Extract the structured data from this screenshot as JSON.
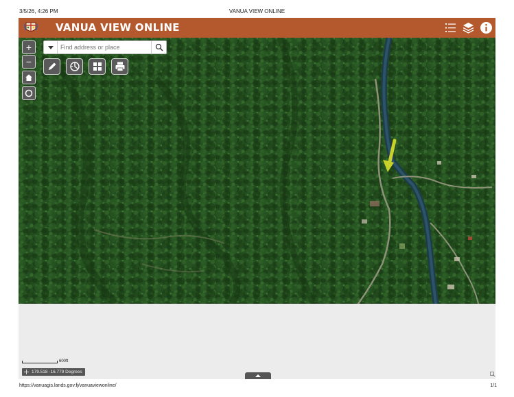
{
  "print": {
    "date": "3/5/26, 4:26 PM",
    "doc_title": "VANUA VIEW ONLINE",
    "url": "https://vanuagis.lands.gov.fj/vanuaviewonline/",
    "page_number": "1/1"
  },
  "app": {
    "title": "VANUA VIEW ONLINE",
    "header_color": "#b4582e"
  },
  "header_icons": [
    "list-icon",
    "layers-icon",
    "info-icon"
  ],
  "map_controls": {
    "zoom_in": "+",
    "zoom_out": "−"
  },
  "search": {
    "placeholder": "Find address or place"
  },
  "tools": [
    "draw-pencil-icon",
    "measure-icon",
    "basemap-gallery-icon",
    "print-icon"
  ],
  "scale": {
    "label": "600ft"
  },
  "coordinates": {
    "text": "179.518 -16.779 Degrees"
  }
}
